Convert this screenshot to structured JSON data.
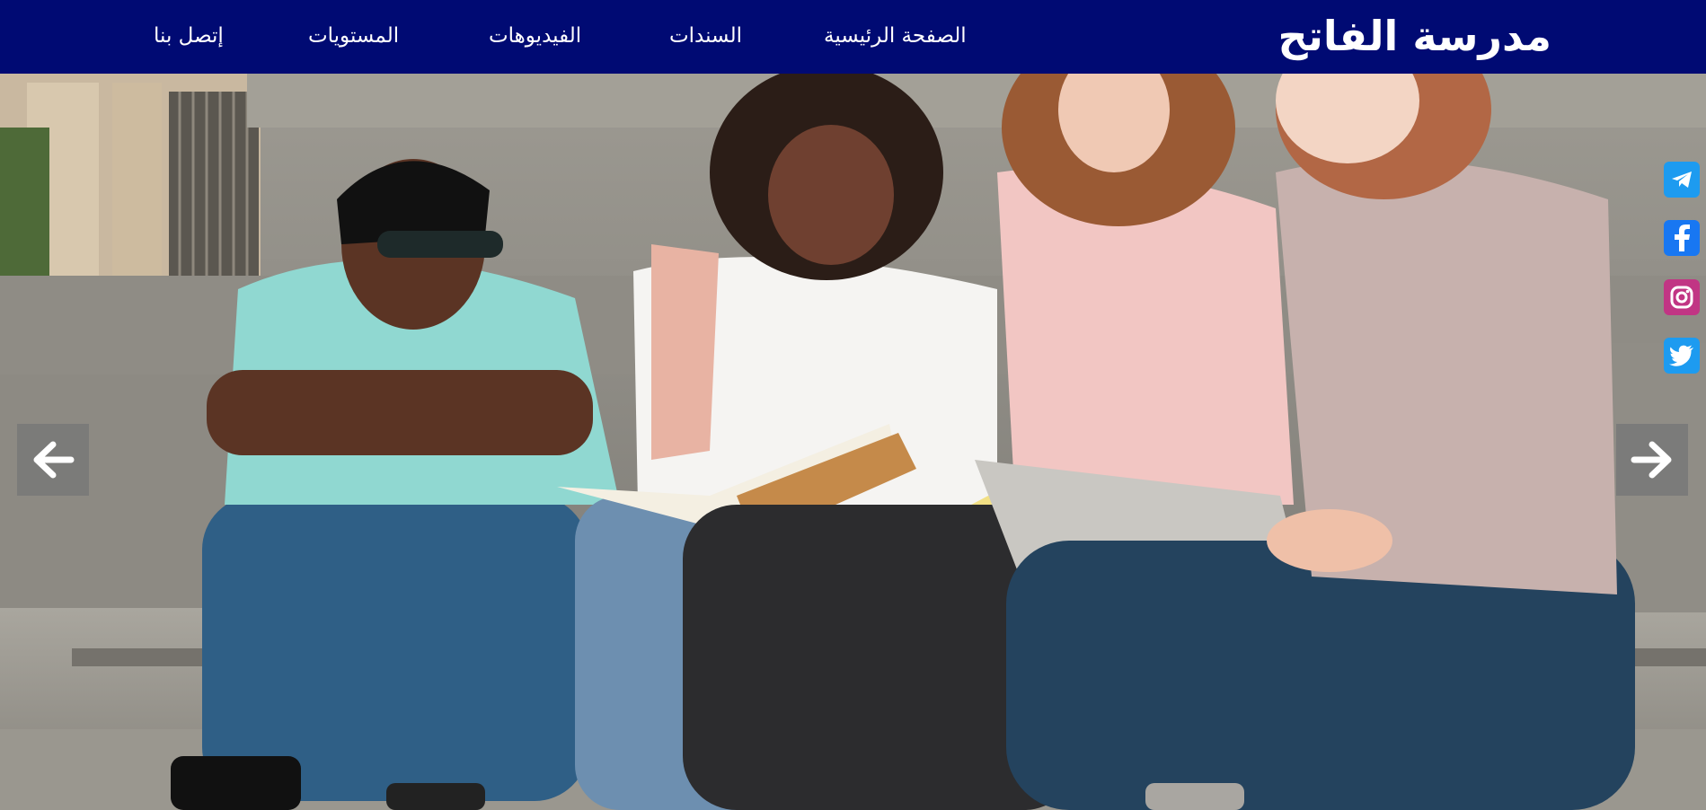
{
  "header": {
    "brand": "مدرسة الفاتح",
    "nav": [
      {
        "label": "الصفحة الرئيسية"
      },
      {
        "label": "السندات"
      },
      {
        "label": "الفيديوهات"
      },
      {
        "label": "المستويات"
      },
      {
        "label": "إتصل بنا"
      }
    ]
  },
  "hero": {
    "image": "students-on-steps-photo",
    "prev_icon": "arrow-left-icon",
    "next_icon": "arrow-right-icon"
  },
  "social": [
    {
      "icon": "telegram-icon",
      "color": "#1d9bf0"
    },
    {
      "icon": "facebook-icon",
      "color": "#1877f2"
    },
    {
      "icon": "instagram-icon",
      "color": "#c13584"
    },
    {
      "icon": "twitter-icon",
      "color": "#1d9bf0"
    }
  ],
  "colors": {
    "navbar": "#000a73",
    "nav_text": "#ffffff",
    "arrow_bg": "#787878"
  }
}
